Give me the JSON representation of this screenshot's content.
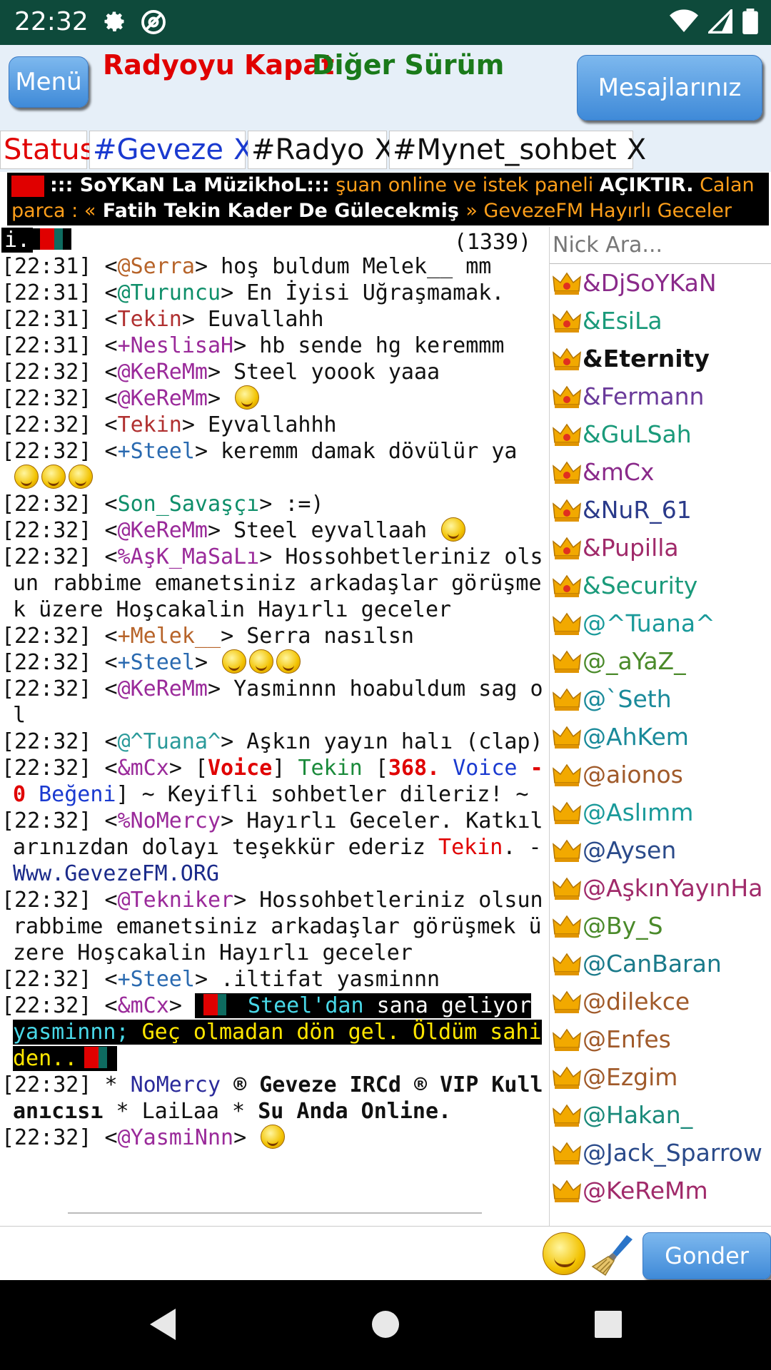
{
  "status_bar": {
    "time": "22:32"
  },
  "header": {
    "menu_label": "Menü",
    "radio_close": "Radyoyu Kapat",
    "other_version": "Diğer Sürüm",
    "messages_label": "Mesajlarınız"
  },
  "tabs": [
    {
      "label": "Status",
      "close": ""
    },
    {
      "label": "#Geveze",
      "close": "X"
    },
    {
      "label": "#Radyo",
      "close": "X"
    },
    {
      "label": "#Mynet_sohbet",
      "close": "X"
    }
  ],
  "ticker": {
    "part1": "::: SoYKaN La MüzikhoL:::",
    "part2": " şuan online ve istek paneli ",
    "part3": "AÇIKTIR.",
    "part4": " Calan parca : «",
    "part5": " Fatih Tekin Kader De Gülecekmiş ",
    "part6": "» GevezeFM Hayırlı Geceler Diler."
  },
  "chat": {
    "count": "(1339)",
    "top_fragment": "i.",
    "m1": {
      "ts": "[22:31]",
      "nick": "@Serra",
      "text": "hoş buldum Melek__ mm"
    },
    "m2": {
      "ts": "[22:31]",
      "nick": "@Turuncu",
      "text": "En İyisi Uğraşmamak."
    },
    "m3": {
      "ts": "[22:31]",
      "nick": "Tekin",
      "text": "Euvallahh"
    },
    "m4": {
      "ts": "[22:31]",
      "nick": "+NeslisaH",
      "text": "hb sende hg keremmm"
    },
    "m5": {
      "ts": "[22:32]",
      "nick": "@KeReMm",
      "text": "Steel yoook yaaa"
    },
    "m6": {
      "ts": "[22:32]",
      "nick": "@KeReMm",
      "text": ""
    },
    "m7": {
      "ts": "[22:32]",
      "nick": "Tekin",
      "text": "Eyvallahhh"
    },
    "m8": {
      "ts": "[22:32]",
      "nick": "+Steel",
      "text": "keremm damak dövülür ya"
    },
    "m9": {
      "ts": "[22:32]",
      "nick": "Son_Savaşçı",
      "text": ":=)"
    },
    "m10": {
      "ts": "[22:32]",
      "nick": "@KeReMm",
      "text": "Steel eyvallaah"
    },
    "m11": {
      "ts": "[22:32]",
      "nick": "%AşK_MaSaLı",
      "text": "Hossohbetleriniz olsun rabbime emanetsiniz arkadaşlar görüşmek üzere Hoşcakalin Hayırlı geceler"
    },
    "m12": {
      "ts": "[22:32]",
      "nick": "+Melek__",
      "text": "Serra nasılsn"
    },
    "m13": {
      "ts": "[22:32]",
      "nick": "+Steel",
      "text": ""
    },
    "m14": {
      "ts": "[22:32]",
      "nick": "@KeReMm",
      "text": "Yasminnn hoabuldum sag ol"
    },
    "m15": {
      "ts": "[22:32]",
      "nick": "@^Tuana^",
      "text": "Aşkın yayın halı (clap)"
    },
    "m16": {
      "ts": "[22:32]",
      "nick": "&mCx",
      "open": "[",
      "voice": "Voice",
      "close1": "]",
      "tekin": "Tekin",
      "open2": "[",
      "num": "368.",
      "voice2": "Voice",
      "dash": "- 0",
      "begeni": "Beğeni",
      "rest": "] ~ Keyifli sohbetler dileriz! ~"
    },
    "m17": {
      "ts": "[22:32]",
      "nick": "%NoMercy",
      "text": "Hayırlı Geceler. Katkılarınızdan dolayı teşekkür ederiz",
      "tekin": "Tekin",
      "dot": ". -",
      "site": "Www.GevezeFM.ORG"
    },
    "m18": {
      "ts": "[22:32]",
      "nick": "@Tekniker",
      "text": "Hossohbetleriniz olsun rabbime emanetsiniz arkadaşlar görüşmek üzere Hoşcakalin Hayırlı geceler"
    },
    "m19": {
      "ts": "[22:32]",
      "nick": "+Steel",
      "text": ".iltifat yasminnn"
    },
    "m20": {
      "ts": "[22:32]",
      "nick": "&mCx",
      "steel": "Steel'dan",
      "sana": " sana geliyor ",
      "yas": "yasminnn;",
      "rest": " Geç olmadan dön gel. Öldüm sahiden.."
    },
    "m21": {
      "ts": "[22:32]",
      "star": "*",
      "nick": "NoMercy",
      "vip": "® Geveze IRCd ® VIP Kullanıcısı",
      "mid": " * LaiLaa * ",
      "online": "Su Anda Online."
    },
    "m22": {
      "ts": "[22:32]",
      "nick": "@YasmiNnn",
      "text": ""
    }
  },
  "userlist": {
    "search_placeholder": "Nick Ara...",
    "users": [
      {
        "name": "&DjSoYKaN",
        "color": "#8a2a8a",
        "crown": "owner"
      },
      {
        "name": "&EsiLa",
        "color": "#1a9a7a",
        "crown": "owner"
      },
      {
        "name": "&Eternity",
        "color": "#111111",
        "crown": "owner"
      },
      {
        "name": "&Fermann",
        "color": "#6a3a9a",
        "crown": "owner"
      },
      {
        "name": "&GuLSah",
        "color": "#1a9a7a",
        "crown": "owner"
      },
      {
        "name": "&mCx",
        "color": "#8a2a8a",
        "crown": "owner"
      },
      {
        "name": "&NuR_61",
        "color": "#2a3a8a",
        "crown": "owner"
      },
      {
        "name": "&Pupilla",
        "color": "#a02a6a",
        "crown": "owner"
      },
      {
        "name": "&Security",
        "color": "#1a9a7a",
        "crown": "owner"
      },
      {
        "name": "@^Tuana^",
        "color": "#1a9a9a",
        "crown": "op"
      },
      {
        "name": "@_aYaZ_",
        "color": "#4a8a2a",
        "crown": "op"
      },
      {
        "name": "@`Seth",
        "color": "#1a8a9a",
        "crown": "op"
      },
      {
        "name": "@AhKem",
        "color": "#1a8a9a",
        "crown": "op"
      },
      {
        "name": "@aionos",
        "color": "#a05a2a",
        "crown": "op"
      },
      {
        "name": "@Aslımm",
        "color": "#1a9a9a",
        "crown": "op"
      },
      {
        "name": "@Aysen",
        "color": "#2a4a8a",
        "crown": "op"
      },
      {
        "name": "@AşkınYayınHa",
        "color": "#a02a6a",
        "crown": "op"
      },
      {
        "name": "@By_S",
        "color": "#4a8a2a",
        "crown": "op"
      },
      {
        "name": "@CanBaran",
        "color": "#1a7a8a",
        "crown": "op"
      },
      {
        "name": "@dilekce",
        "color": "#a05a2a",
        "crown": "op"
      },
      {
        "name": "@Enfes",
        "color": "#a05a2a",
        "crown": "op"
      },
      {
        "name": "@Ezgim",
        "color": "#a05a2a",
        "crown": "op"
      },
      {
        "name": "@Hakan_",
        "color": "#1a8a7a",
        "crown": "op"
      },
      {
        "name": "@Jack_Sparrow",
        "color": "#2a4a8a",
        "crown": "op"
      },
      {
        "name": "@KeReMm",
        "color": "#a02a6a",
        "crown": "op"
      }
    ]
  },
  "input": {
    "placeholder": "",
    "send_label": "Gonder"
  },
  "colors": {
    "status_bar": "#0e4a3b",
    "header_bg": "#e6eff8",
    "button_blue": "#3f8ad8"
  }
}
